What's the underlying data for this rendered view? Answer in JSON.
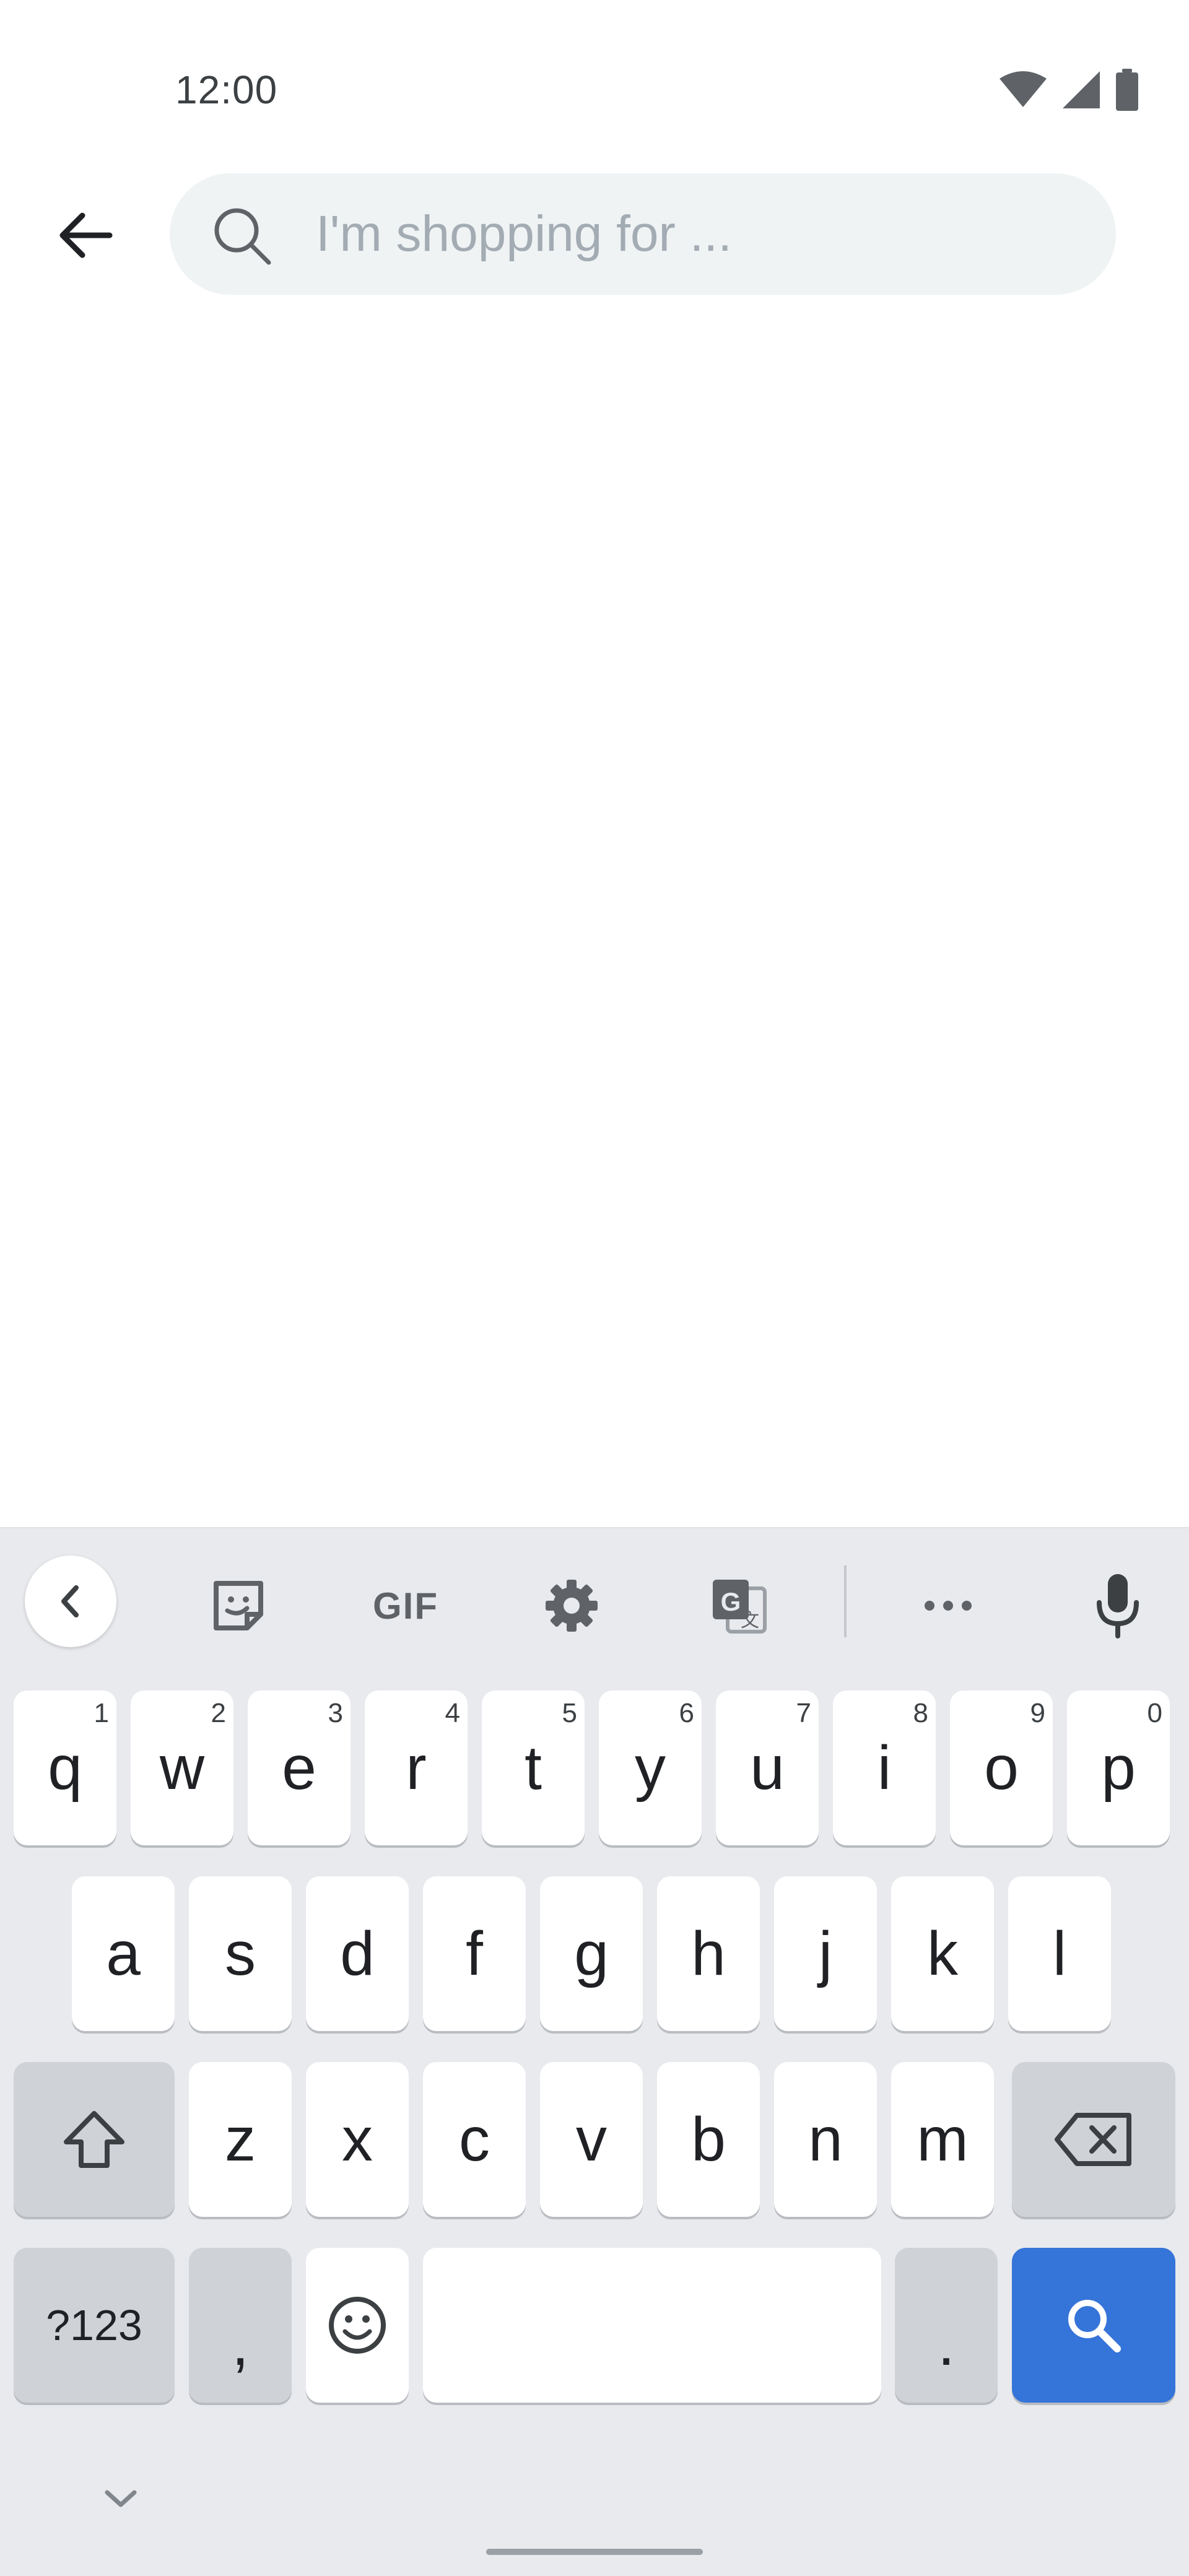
{
  "status_bar": {
    "time": "12:00",
    "icons": [
      "wifi-icon",
      "cellular-signal-icon",
      "battery-icon"
    ]
  },
  "header": {
    "back_icon": "arrow-back-icon",
    "search": {
      "icon": "search-icon",
      "placeholder": "I'm shopping for ...",
      "value": ""
    }
  },
  "keyboard": {
    "toolbar": {
      "items": [
        "chevron-left-icon",
        "sticker-icon",
        "GIF",
        "gear-icon",
        "translate-icon",
        "more-icon",
        "microphone-icon"
      ],
      "gif_label": "GIF"
    },
    "row1": [
      {
        "key": "q",
        "hint": "1"
      },
      {
        "key": "w",
        "hint": "2"
      },
      {
        "key": "e",
        "hint": "3"
      },
      {
        "key": "r",
        "hint": "4"
      },
      {
        "key": "t",
        "hint": "5"
      },
      {
        "key": "y",
        "hint": "6"
      },
      {
        "key": "u",
        "hint": "7"
      },
      {
        "key": "i",
        "hint": "8"
      },
      {
        "key": "o",
        "hint": "9"
      },
      {
        "key": "p",
        "hint": "0"
      }
    ],
    "row2": [
      "a",
      "s",
      "d",
      "f",
      "g",
      "h",
      "j",
      "k",
      "l"
    ],
    "row3": [
      "z",
      "x",
      "c",
      "v",
      "b",
      "n",
      "m"
    ],
    "row4": {
      "symbols_label": "?123",
      "comma": ",",
      "period": "."
    },
    "icons": {
      "shift": "shift-icon",
      "backspace": "backspace-icon",
      "emoji": "emoji-icon",
      "search": "search-icon",
      "hide": "chevron-down-icon"
    },
    "colors": {
      "background": "#e8eaed",
      "key": "#ffffff",
      "function_key": "#cfd2d7",
      "action_key": "#3574d9"
    }
  }
}
